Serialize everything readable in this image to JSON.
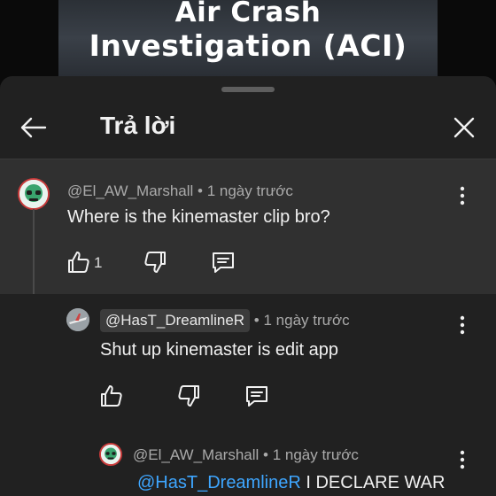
{
  "video": {
    "title_line1": "Air Crash",
    "title_line2": "Investigation (ACI)"
  },
  "header": {
    "title": "Trả lời",
    "back_icon": "arrow-left-icon",
    "close_icon": "close-icon"
  },
  "comments": [
    {
      "author": "@El_AW_Marshall",
      "separator": " • ",
      "time": "1 ngày trước",
      "text": "Where is the kinemaster clip bro?",
      "like_count": "1"
    },
    {
      "author": "@HasT_DreamlineR",
      "separator": " • ",
      "time": "1 ngày trước",
      "text": "Shut up kinemaster is edit app"
    },
    {
      "author": "@El_AW_Marshall",
      "separator": " • ",
      "time": "1 ngày trước",
      "mention": "@HasT_DreamlineR",
      "text": " I DECLARE WAR"
    }
  ],
  "icons": {
    "like": "thumb-up-icon",
    "dislike": "thumb-down-icon",
    "reply": "reply-comment-icon",
    "more": "more-vertical-icon"
  },
  "colors": {
    "background": "#0f0f0f",
    "sheet": "#212121",
    "highlighted_comment": "#303030",
    "meta_text": "#aaaaaa",
    "link": "#3ea6ff"
  }
}
